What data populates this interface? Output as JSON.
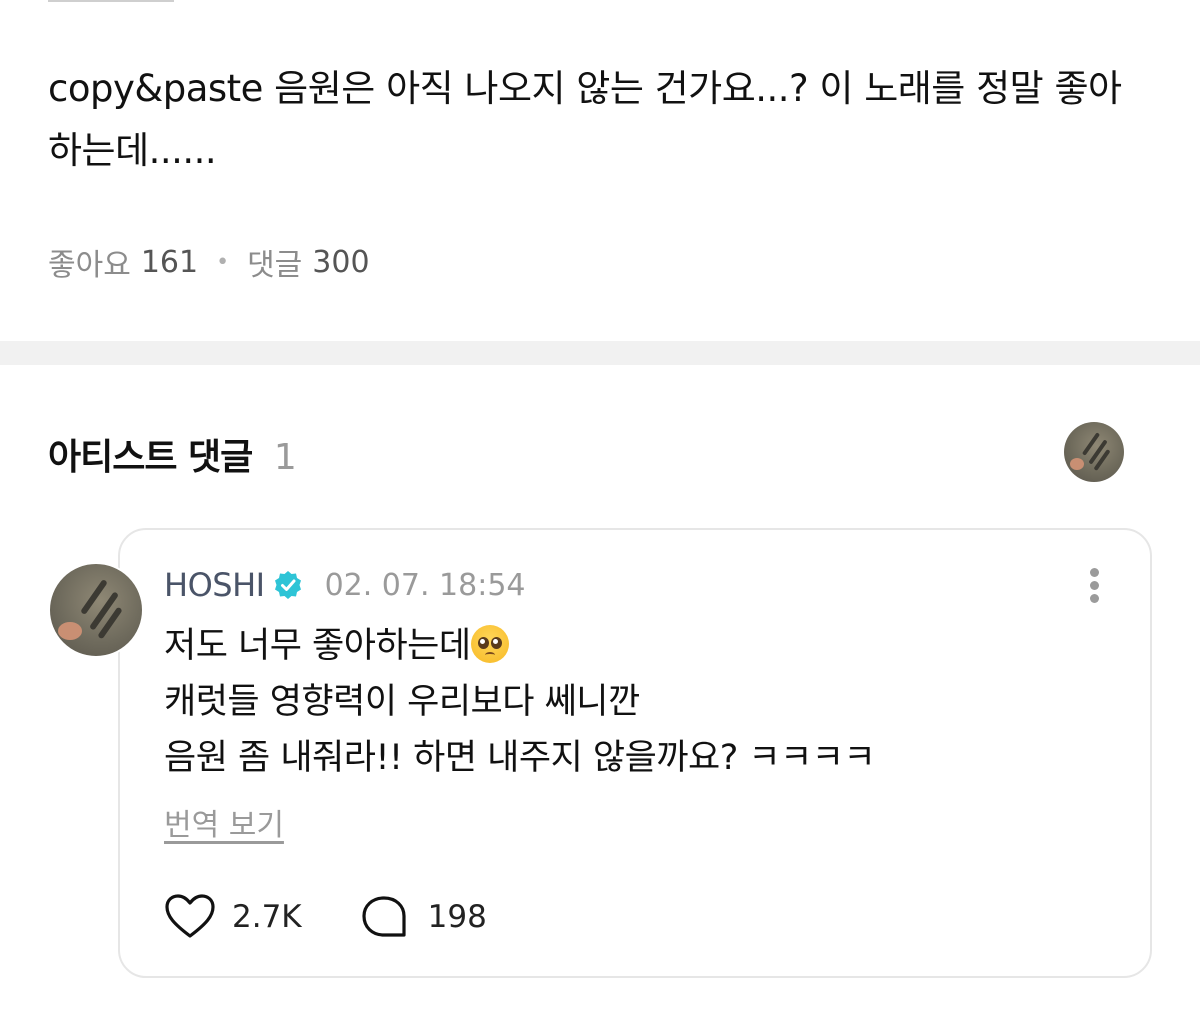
{
  "post": {
    "text": "copy&paste 음원은 아직 나오지 않는 건가요...? 이 노래를 정말 좋아하는데......",
    "likes_label": "좋아요",
    "likes_count": "161",
    "comments_label": "댓글",
    "comments_count": "300"
  },
  "artist_comments": {
    "title": "아티스트 댓글",
    "count": "1"
  },
  "comment": {
    "author": "HOSHI",
    "timestamp": "02. 07. 18:54",
    "lines": [
      "저도 너무 좋아하는데",
      "캐럿들 영향력이 우리보다 쎄니깐",
      "음원 좀 내줘라!! 하면 내주지 않을까요? ㅋㅋㅋㅋ"
    ],
    "translate_label": "번역 보기",
    "like_count": "2.7K",
    "reply_count": "198"
  },
  "colors": {
    "verified": "#2ec4d6",
    "divider": "#f1f1f1",
    "muted": "#9a9a9a"
  },
  "icons": [
    "verified-badge-icon",
    "more-options-icon",
    "heart-icon",
    "comment-bubble-icon",
    "pleading-face-icon"
  ]
}
